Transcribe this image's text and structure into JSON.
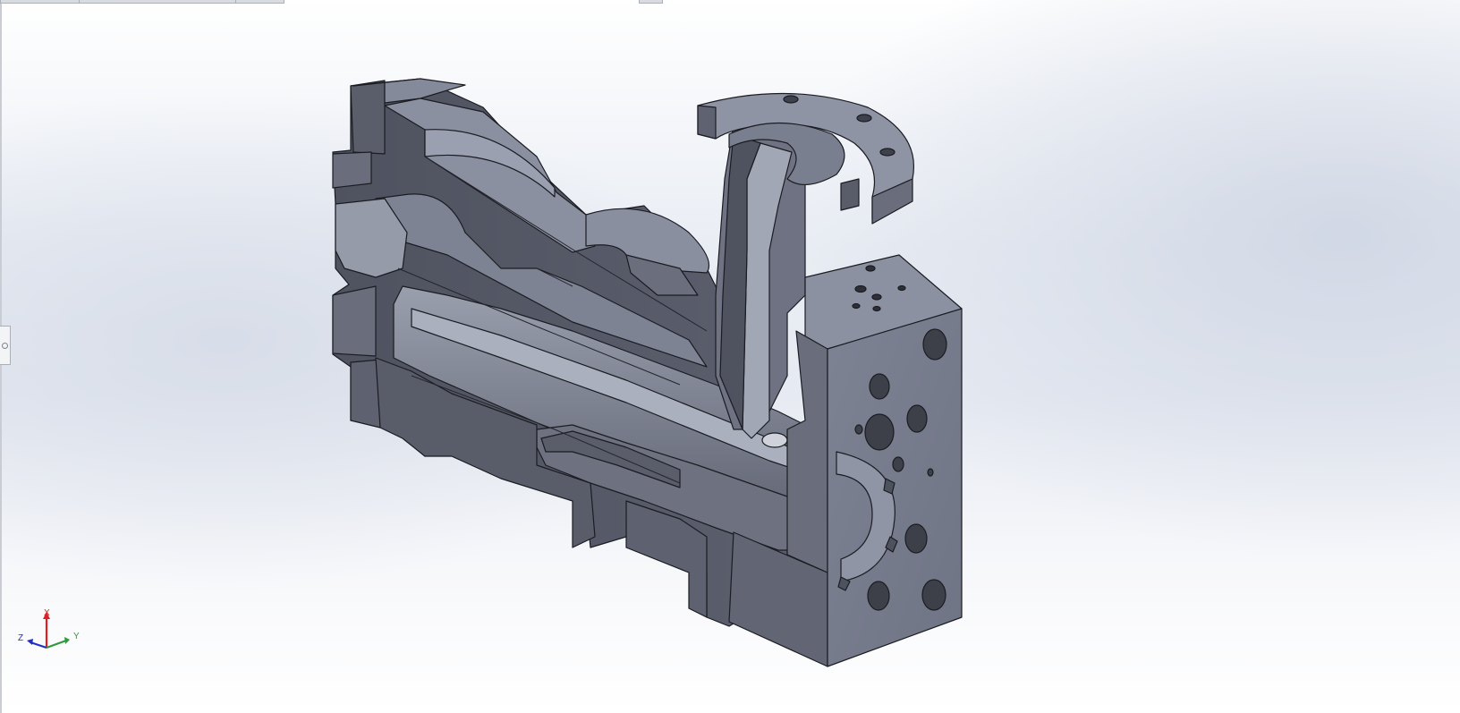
{
  "viewport": {
    "background_top": "#ffffff",
    "background_mid": "#e6eaf2",
    "model_face_color": "#7b8090",
    "model_dark_color": "#505461",
    "model_edge_color": "#1b1c22"
  },
  "triad": {
    "x_label": "X",
    "y_label": "Y",
    "z_label": "Z",
    "x_color": "#e02020",
    "y_color": "#2f9a3c",
    "z_color": "#1f2fc8"
  },
  "side_panel_handle": {
    "icon": "collapse-handle-icon"
  }
}
